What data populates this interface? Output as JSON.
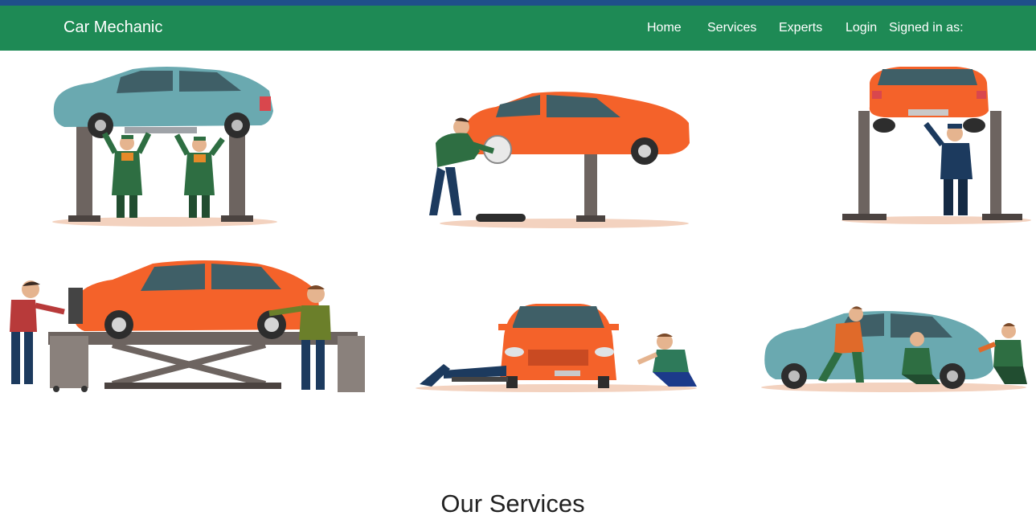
{
  "navbar": {
    "brand": "Car Mechanic",
    "links": [
      "Home",
      "Services",
      "Experts",
      "Login"
    ],
    "signed_in": "Signed in as:"
  },
  "gallery": {
    "illustrations": [
      "car-on-two-post-lift-with-two-mechanics",
      "mechanic-changing-wheel-on-lifted-car",
      "mechanic-under-lifted-car",
      "mechanics-at-scissor-lift",
      "mechanic-under-car-and-mechanic-at-wheel",
      "three-mechanics-around-car"
    ]
  },
  "services": {
    "heading": "Our Services"
  },
  "colors": {
    "navbar": "#1e8a55",
    "topstrip": "#1f4f8a",
    "orange_car": "#f4622a",
    "teal_car": "#6aa9b0"
  }
}
